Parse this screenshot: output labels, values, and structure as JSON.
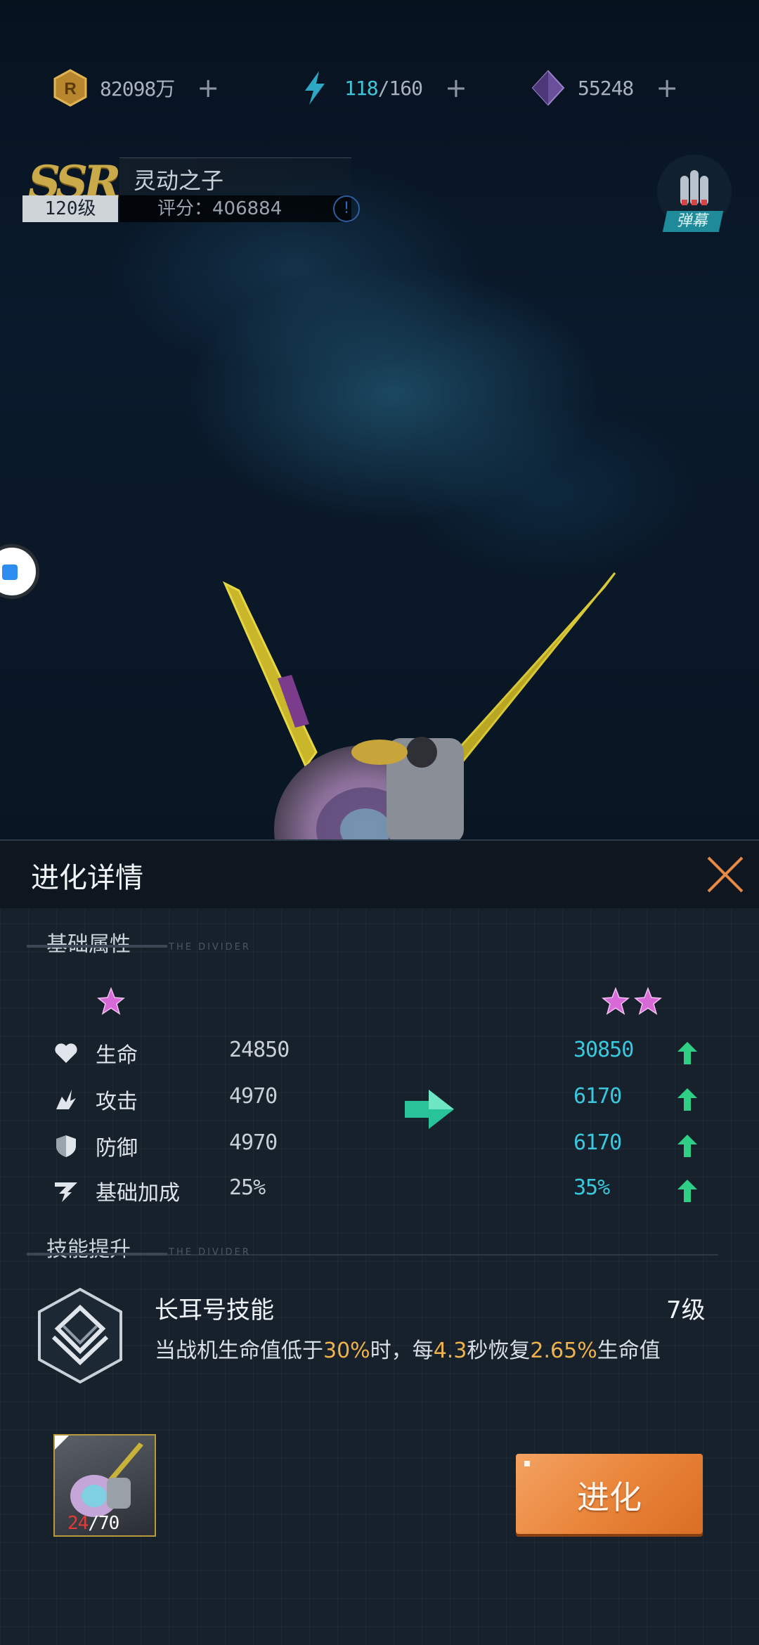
{
  "resources": {
    "gold": "82098万",
    "energy_current": "118",
    "energy_max": "/160",
    "crystal": "55248",
    "plus": "+"
  },
  "ship": {
    "rarity": "SSR",
    "name": "灵动之子",
    "level": "120级",
    "score": "评分：406884"
  },
  "bullet_button_label": "弹幕",
  "panel": {
    "title": "进化详情",
    "base_section": "基础属性",
    "divider_text": "THE DIVIDER",
    "skill_section": "技能提升",
    "stats": [
      {
        "icon": "heart-icon",
        "name": "生命",
        "old": "24850",
        "new": "30850"
      },
      {
        "icon": "attack-icon",
        "name": "攻击",
        "old": "4970",
        "new": "6170"
      },
      {
        "icon": "shield-icon",
        "name": "防御",
        "old": "4970",
        "new": "6170"
      },
      {
        "icon": "bonus-icon",
        "name": "基础加成",
        "old": "25%",
        "new": "35%"
      }
    ],
    "stars_before": 1,
    "stars_after": 2,
    "skill": {
      "name": "长耳号技能",
      "level": "7级",
      "desc_1": "当战机生命值低于",
      "desc_2": "30%",
      "desc_3": "时，每",
      "desc_4": "4.3",
      "desc_5": "秒恢复",
      "desc_6": "2.65%",
      "desc_7": "生命值"
    },
    "material": {
      "current": "24",
      "required": "/70"
    },
    "evolve_button": "进化"
  },
  "colors": {
    "accent_cyan": "#3bc7dd",
    "up_green": "#2fcf86",
    "highlight_orange": "#f0b24a",
    "button_orange": "#e88338"
  }
}
